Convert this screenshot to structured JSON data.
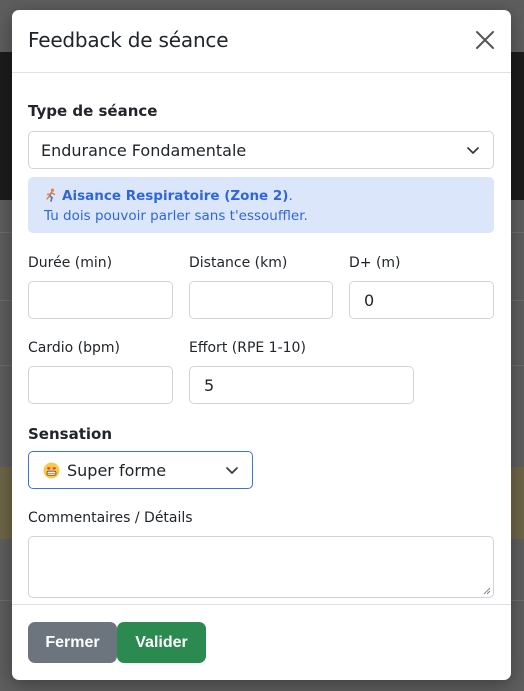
{
  "modal": {
    "title": "Feedback de séance",
    "close_label": "×"
  },
  "session_type": {
    "label": "Type de séance",
    "selected": "Endurance Fondamentale",
    "info_icon": "running-person-icon",
    "info_title": "Aisance Respiratoire (Zone 2)",
    "info_title_suffix": ".",
    "info_text": "Tu dois pouvoir parler sans t'essouffler."
  },
  "fields": {
    "duration": {
      "label": "Durée (min)",
      "value": ""
    },
    "distance": {
      "label": "Distance (km)",
      "value": ""
    },
    "elevation": {
      "label": "D+ (m)",
      "value": "0"
    },
    "heart_rate": {
      "label": "Cardio (bpm)",
      "value": ""
    },
    "effort": {
      "label": "Effort (RPE 1-10)",
      "value": "5"
    }
  },
  "sensation": {
    "label": "Sensation",
    "emoji": "grinning-face-icon",
    "selected": "Super forme"
  },
  "comments": {
    "label": "Commentaires / Détails",
    "value": ""
  },
  "footer": {
    "close_button": "Fermer",
    "submit_button": "Valider"
  },
  "colors": {
    "primary_blue": "#3b73d8",
    "info_bg": "#dbe6fb",
    "info_text": "#2f67d8",
    "secondary": "#6c757d",
    "success": "#2a8a4f"
  }
}
